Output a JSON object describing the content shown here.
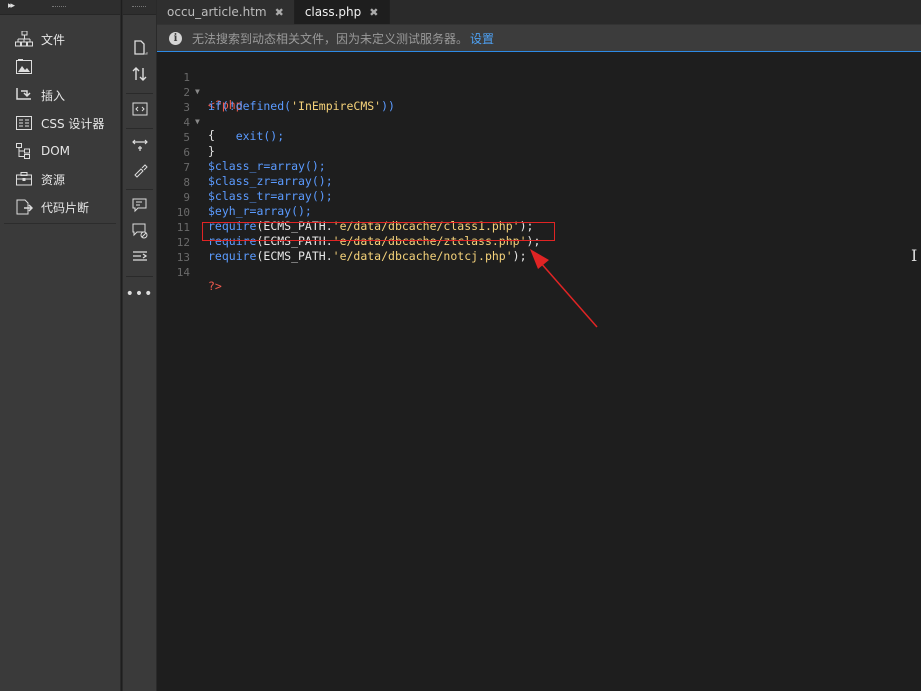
{
  "left_panel": {
    "items": [
      {
        "label": "文件",
        "icon": "sitemap-icon"
      },
      {
        "label": "",
        "icon": "image-assets-icon"
      },
      {
        "label": "插入",
        "icon": "insert-icon"
      },
      {
        "label": "CSS 设计器",
        "icon": "css-designer-icon"
      },
      {
        "label": "DOM",
        "icon": "dom-tree-icon"
      },
      {
        "label": "资源",
        "icon": "assets-icon"
      },
      {
        "label": "代码片断",
        "icon": "snippets-icon"
      }
    ]
  },
  "tabs": [
    {
      "label": "occu_article.htm",
      "close": "✖"
    },
    {
      "label": "class.php",
      "close": "✖"
    }
  ],
  "infobar": {
    "icon": "i",
    "message": "无法搜索到动态相关文件，因为未定义测试服务器。",
    "link": "设置"
  },
  "editor": {
    "line_numbers": [
      "1",
      "2",
      "3",
      "4",
      "5",
      "6",
      "7",
      "8",
      "9",
      "10",
      "11",
      "12",
      "13",
      "14"
    ],
    "lines": {
      "l1": {
        "open": "<?php"
      },
      "l2": {
        "a": "if(!defined(",
        "b": "'InEmpireCMS'",
        "c": "))"
      },
      "l3": {
        "a": "{"
      },
      "l4": {
        "a": "    exit();"
      },
      "l5": {
        "a": "}"
      },
      "l6": {
        "var": "$class_r",
        "rest": "=array();"
      },
      "l7": {
        "var": "$class_zr",
        "rest": "=array();"
      },
      "l8": {
        "var": "$class_tr",
        "rest": "=array();"
      },
      "l9": {
        "var": "$eyh_r",
        "rest": "=array();"
      },
      "l10": {
        "fn": "require",
        "p1": "(ECMS_PATH.",
        "s": "'e/data/dbcache/class1.php'",
        "p2": ");"
      },
      "l11": {
        "fn": "require",
        "p1": "(ECMS_PATH.",
        "s": "'e/data/dbcache/ztclass.php'",
        "p2": ");"
      },
      "l12": {
        "fn": "require",
        "p1": "(ECMS_PATH.",
        "s": "'e/data/dbcache/notcj.php'",
        "p2": ");"
      },
      "l14": {
        "close": "?>"
      }
    }
  },
  "colors": {
    "annotation_red": "#e02424",
    "accent_blue": "#2d8ae6"
  }
}
